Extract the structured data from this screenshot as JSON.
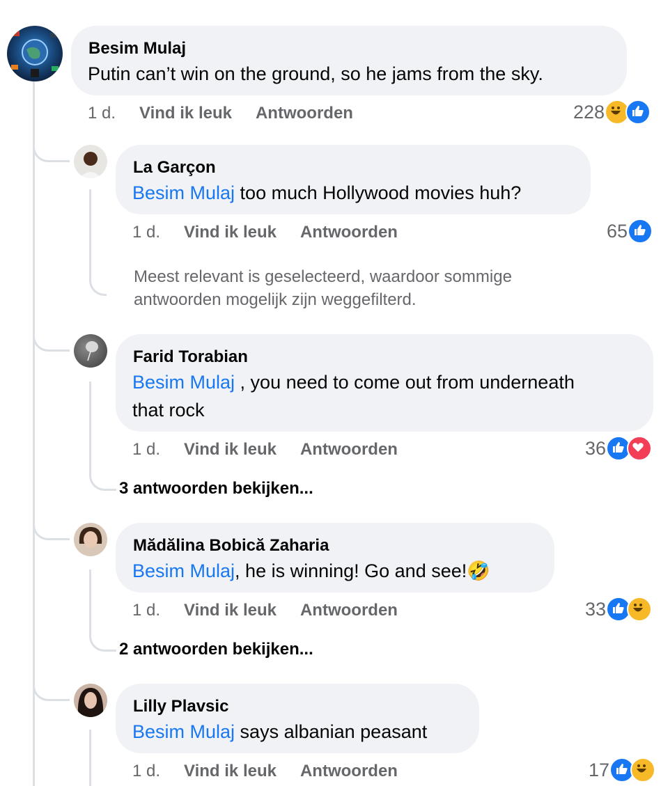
{
  "comments": [
    {
      "author": "Besim Mulaj",
      "text": "Putin can’t win on the ground, so he jams from the sky.",
      "time": "1 d.",
      "like_label": "Vind ik leuk",
      "reply_label": "Antwoorden",
      "reaction_count": "228",
      "reactions": [
        "haha-icon",
        "like-icon"
      ]
    },
    {
      "author": "La Garçon",
      "mention": "Besim Mulaj",
      "text": " too much Hollywood movies huh?",
      "time": "1 d.",
      "like_label": "Vind ik leuk",
      "reply_label": "Antwoorden",
      "reaction_count": "65",
      "reactions": [
        "like-icon"
      ]
    },
    {
      "author": "Farid Torabian",
      "mention": "Besim Mulaj",
      "text_line1": " , you need to come out from underneath",
      "text_line2": "that rock",
      "time": "1 d.",
      "like_label": "Vind ik leuk",
      "reply_label": "Antwoorden",
      "reaction_count": "36",
      "reactions": [
        "like-icon",
        "love-icon"
      ],
      "view_replies": "3 antwoorden bekijken..."
    },
    {
      "author": "Mădălina Bobică Zaharia",
      "mention": "Besim Mulaj",
      "text": ", he is winning! Go and see!",
      "emoji": "🤣",
      "time": "1 d.",
      "like_label": "Vind ik leuk",
      "reply_label": "Antwoorden",
      "reaction_count": "33",
      "reactions": [
        "like-icon",
        "haha-icon"
      ],
      "view_replies": "2 antwoorden bekijken..."
    },
    {
      "author": "Lilly Plavsic",
      "mention": "Besim Mulaj",
      "text": " says albanian peasant",
      "time": "1 d.",
      "like_label": "Vind ik leuk",
      "reply_label": "Antwoorden",
      "reaction_count": "17",
      "reactions": [
        "like-icon",
        "haha-icon"
      ]
    }
  ],
  "filter_note_line1": "Meest relevant is geselecteerd, waardoor sommige",
  "filter_note_line2": "antwoorden mogelijk zijn weggefilterd.",
  "colors": {
    "mention": "#1877f2",
    "like": "#1877f2",
    "love": "#f33e58",
    "haha": "#f7b928",
    "bubble": "#f0f2f5"
  }
}
